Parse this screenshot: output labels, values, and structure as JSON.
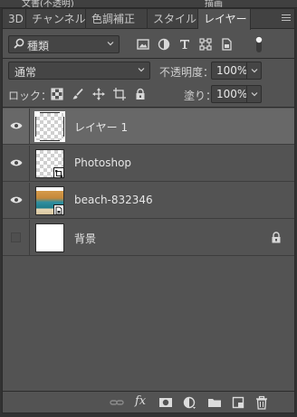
{
  "top_strip": {
    "left_fragment": "文書(不透明)",
    "right_fragment": "描画"
  },
  "tabs": [
    {
      "label": "3D",
      "active": false
    },
    {
      "label": "チャンネル",
      "active": false
    },
    {
      "label": "色調補正",
      "active": false
    },
    {
      "label": "スタイル",
      "active": false
    },
    {
      "label": "レイヤー",
      "active": true
    }
  ],
  "filter": {
    "kind_label": "種類",
    "icons": [
      "image-filter-icon",
      "adjustment-filter-icon",
      "type-filter-icon",
      "shape-filter-icon",
      "smart-object-filter-icon",
      "filter-toggle-icon"
    ]
  },
  "blend": {
    "mode": "通常",
    "opacity_label": "不透明度：",
    "opacity_value": "100%"
  },
  "lock": {
    "label": "ロック：",
    "icons": [
      "lock-transparent-pixels-icon",
      "lock-image-pixels-icon",
      "lock-position-icon",
      "lock-artboard-icon",
      "lock-all-icon"
    ],
    "fill_label": "塗り：",
    "fill_value": "100%"
  },
  "layers": [
    {
      "name": "レイヤー 1",
      "visible": true,
      "selected": true,
      "thumb": "transparent"
    },
    {
      "name": "Photoshop",
      "visible": true,
      "selected": false,
      "thumb": "shape"
    },
    {
      "name": "beach-832346",
      "visible": true,
      "selected": false,
      "thumb": "smart-image"
    },
    {
      "name": "背景",
      "visible": false,
      "selected": false,
      "thumb": "white",
      "locked": true
    }
  ],
  "footer": {
    "icons": [
      "link-layers-icon",
      "fx-icon",
      "add-mask-icon",
      "adjustment-layer-icon",
      "new-group-icon",
      "new-layer-icon",
      "delete-layer-icon"
    ],
    "fx_label": "fx"
  },
  "colors": {
    "panel": "#535353",
    "selected_layer": "#686868",
    "tabbar": "#424242"
  }
}
